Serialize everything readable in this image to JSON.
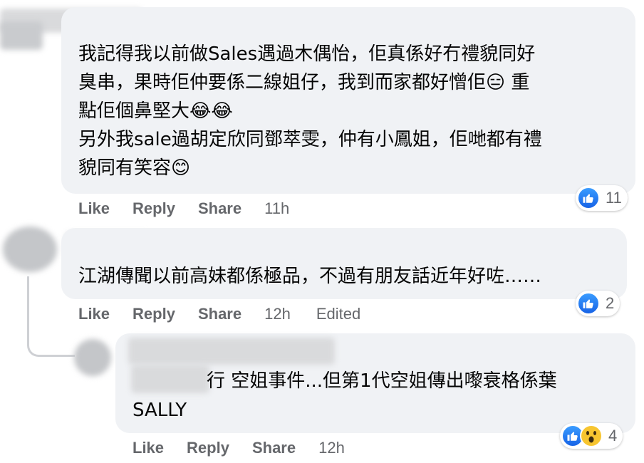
{
  "comments": [
    {
      "text": "我記得我以前做Sales遇過木偶怡，佢真係好冇禮貌同好\n臭串，果時佢仲要係二線姐仔，我到而家都好憎佢😑 重\n點佢個鼻堅大😂😂\n另外我sale過胡定欣同鄧萃雯，仲有小鳳姐，佢哋都有禮\n貌同有笑容😊",
      "actions": {
        "like": "Like",
        "reply": "Reply",
        "share": "Share"
      },
      "time": "11h",
      "reaction_count": "11",
      "reactions": [
        "like-icon"
      ]
    },
    {
      "text": "江湖傳聞以前高妹都係極品，不過有朋友話近年好咗……",
      "actions": {
        "like": "Like",
        "reply": "Reply",
        "share": "Share"
      },
      "time": "12h",
      "edited": "Edited",
      "reaction_count": "2",
      "reactions": [
        "like-icon"
      ]
    },
    {
      "text_line1": "行 空姐事件...但第1代空姐傳出嚟衰格係葉",
      "text_line2": "SALLY",
      "actions": {
        "like": "Like",
        "reply": "Reply",
        "share": "Share"
      },
      "time": "12h",
      "reaction_count": "4",
      "reactions": [
        "like-icon",
        "wow-icon"
      ]
    }
  ],
  "colors": {
    "bubble": "#f0f2f5",
    "action": "#65676b",
    "like": "#1877f2",
    "emoji": "#f7c530"
  }
}
